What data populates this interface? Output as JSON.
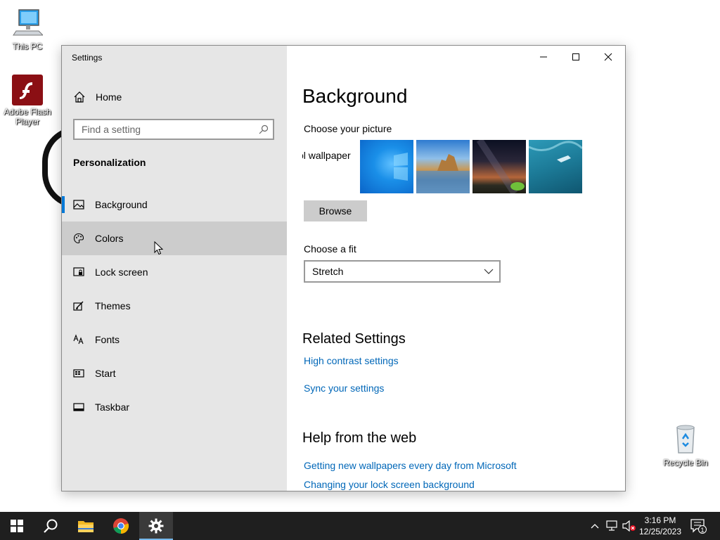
{
  "desktop": {
    "icons": [
      {
        "name": "this-pc",
        "label": "This PC"
      },
      {
        "name": "adobe-flash",
        "label": "Adobe Flash Player"
      },
      {
        "name": "recycle-bin",
        "label": "Recycle Bin"
      }
    ]
  },
  "window": {
    "title": "Settings",
    "controls": [
      "minimize",
      "maximize",
      "close"
    ]
  },
  "sidebar": {
    "home_label": "Home",
    "search_placeholder": "Find a setting",
    "section_title": "Personalization",
    "items": [
      {
        "label": "Background",
        "icon": "picture-icon",
        "selected": true
      },
      {
        "label": "Colors",
        "icon": "palette-icon",
        "hover": true
      },
      {
        "label": "Lock screen",
        "icon": "lock-screen-icon"
      },
      {
        "label": "Themes",
        "icon": "brush-icon"
      },
      {
        "label": "Fonts",
        "icon": "font-icon"
      },
      {
        "label": "Start",
        "icon": "start-icon"
      },
      {
        "label": "Taskbar",
        "icon": "taskbar-icon"
      }
    ]
  },
  "main": {
    "title": "Background",
    "choose_picture_label": "Choose your picture",
    "thumb_text": "ol wallpaper",
    "browse_label": "Browse",
    "choose_fit_label": "Choose a fit",
    "fit_value": "Stretch",
    "related_title": "Related Settings",
    "related_links": [
      "High contrast settings",
      "Sync your settings"
    ],
    "help_title": "Help from the web",
    "help_links": [
      "Getting new wallpapers every day from Microsoft",
      "Changing your lock screen background"
    ]
  },
  "taskbar": {
    "apps": [
      "start",
      "search",
      "file-explorer",
      "chrome",
      "settings"
    ],
    "time": "3:16 PM",
    "date": "12/25/2023",
    "notification_count": "1"
  },
  "colors": {
    "accent": "#0078d7",
    "link": "#0067b8",
    "sidebar_bg": "#e6e6e6",
    "taskbar_bg": "#1f1f1f"
  }
}
